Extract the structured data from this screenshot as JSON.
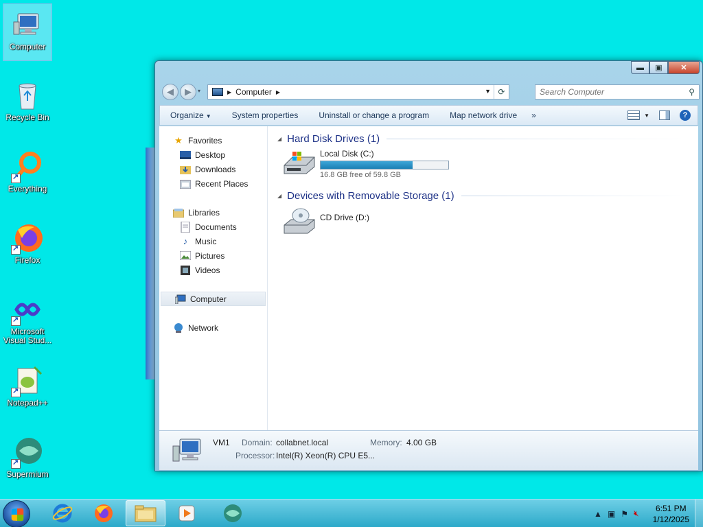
{
  "desktop": {
    "icons": [
      {
        "label": "Computer"
      },
      {
        "label": "Recycle Bin"
      },
      {
        "label": "Everything"
      },
      {
        "label": "Firefox"
      },
      {
        "label": "Microsoft Visual Stud..."
      },
      {
        "label": "Notepad++"
      },
      {
        "label": "Supermium"
      }
    ]
  },
  "window": {
    "address": {
      "crumb": "Computer"
    },
    "search": {
      "placeholder": "Search Computer"
    },
    "commands": {
      "organize": "Organize",
      "system_properties": "System properties",
      "uninstall": "Uninstall or change a program",
      "map_drive": "Map network drive",
      "more": "»"
    },
    "nav": {
      "favorites": "Favorites",
      "desktop": "Desktop",
      "downloads": "Downloads",
      "recent": "Recent Places",
      "libraries": "Libraries",
      "documents": "Documents",
      "music": "Music",
      "pictures": "Pictures",
      "videos": "Videos",
      "computer": "Computer",
      "network": "Network"
    },
    "groups": {
      "hdd_title": "Hard Disk Drives (1)",
      "removable_title": "Devices with Removable Storage (1)"
    },
    "drives": {
      "c": {
        "name": "Local Disk (C:)",
        "free_text": "16.8 GB free of 59.8 GB",
        "used_fraction": 0.72
      },
      "d": {
        "name": "CD Drive (D:)"
      }
    },
    "details": {
      "name": "VM1",
      "domain_label": "Domain:",
      "domain_value": "collabnet.local",
      "memory_label": "Memory:",
      "memory_value": "4.00 GB",
      "processor_label": "Processor:",
      "processor_value": "Intel(R) Xeon(R) CPU E5..."
    }
  },
  "taskbar": {
    "clock_time": "6:51 PM",
    "clock_date": "1/12/2025"
  },
  "colors": {
    "desktop_bg": "#00e8e8",
    "group_title": "#1e3287",
    "progress_fill": "#1b7fb4"
  }
}
